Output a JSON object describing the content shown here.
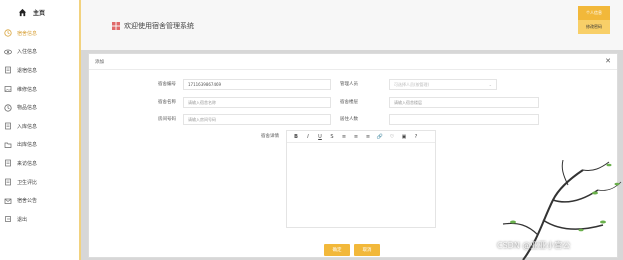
{
  "sidebar": {
    "home": "主页",
    "items": [
      {
        "label": "宿舍信息",
        "icon": "clock-icon",
        "active": true
      },
      {
        "label": "入住信息",
        "icon": "eye-icon",
        "active": false
      },
      {
        "label": "退宿信息",
        "icon": "document-icon",
        "active": false
      },
      {
        "label": "维修信息",
        "icon": "image-icon",
        "active": false
      },
      {
        "label": "物品信息",
        "icon": "clock-icon",
        "active": false
      },
      {
        "label": "入库信息",
        "icon": "document-icon",
        "active": false
      },
      {
        "label": "出库信息",
        "icon": "folder-icon",
        "active": false
      },
      {
        "label": "来访信息",
        "icon": "document-icon",
        "active": false
      },
      {
        "label": "卫生评比",
        "icon": "document-icon",
        "active": false
      },
      {
        "label": "宿舍公告",
        "icon": "envelope-icon",
        "active": false
      },
      {
        "label": "退出",
        "icon": "logout-icon",
        "active": false
      }
    ]
  },
  "header": {
    "system_title": "欢迎使用宿舍管理系统",
    "user_menu_top": "个人信息",
    "user_menu_bottom": "修改密码"
  },
  "modal": {
    "title": "添加",
    "fields": {
      "dorm_no_label": "宿舍编号",
      "dorm_no_value": "1711639867469",
      "dorm_name_label": "宿舍名称",
      "dorm_name_placeholder": "请输入宿舍名称",
      "room_no_label": "房间号码",
      "room_no_placeholder": "请输入房间号码",
      "manager_label": "管理人员",
      "manager_placeholder": "可选择人员(按管理)",
      "building_label": "宿舍楼层",
      "building_placeholder": "请输入宿舍楼层",
      "occupants_label": "居住人数",
      "occupants_value": "",
      "details_label": "宿舍详情"
    },
    "editor_tools": [
      "B",
      "I",
      "U",
      "S",
      "≡",
      "≡",
      "≡",
      "🔗",
      "♡",
      "▣",
      "?"
    ],
    "buttons": {
      "confirm": "确定",
      "cancel": "取消"
    }
  },
  "watermark": "CSDN @亚亚小宫公"
}
